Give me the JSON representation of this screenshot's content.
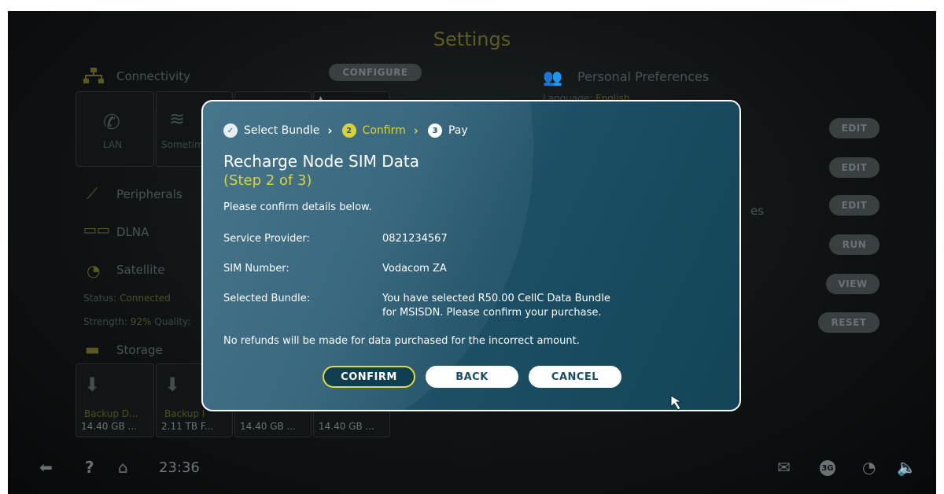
{
  "background": {
    "title": "Settings",
    "configure_label": "CONFIGURE",
    "sections": {
      "connectivity": "Connectivity",
      "peripherals": "Peripherals",
      "dlna": "DLNA",
      "satellite": "Satellite",
      "storage": "Storage",
      "personal_preferences": "Personal Preferences"
    },
    "language_label": "Language:",
    "language_value": "English",
    "tiles": {
      "lan": "LAN",
      "sometimes": "Sometim"
    },
    "status_label": "Status:",
    "status_value": "Connected",
    "strength_label": "Strength:",
    "strength_value": "92%",
    "quality_label": "Quality:",
    "storage_items": [
      {
        "name": "Backup D...",
        "size": "14.40 GB ..."
      },
      {
        "name": "Backup I",
        "size": "2.11 TB F..."
      },
      {
        "name": "",
        "size": "14.40 GB ..."
      },
      {
        "name": "",
        "size": "14.40 GB ..."
      }
    ],
    "right_buttons": [
      "EDIT",
      "EDIT",
      "EDIT",
      "RUN",
      "VIEW",
      "RESET"
    ],
    "partial_text": "es",
    "footer": {
      "time": "23:36",
      "help": "?",
      "network_badge": "3G"
    }
  },
  "modal": {
    "steps": [
      {
        "label": "Select Bundle",
        "marker": "✓",
        "state": "done"
      },
      {
        "label": "Confirm",
        "marker": "2",
        "state": "active"
      },
      {
        "label": "Pay",
        "marker": "3",
        "state": "pending"
      }
    ],
    "title": "Recharge Node SIM Data",
    "subtitle": "(Step 2 of 3)",
    "intro": "Please confirm details below.",
    "fields": [
      {
        "label": "Service Provider:",
        "value": "0821234567"
      },
      {
        "label": "SIM Number:",
        "value": "Vodacom ZA"
      },
      {
        "label": "Selected Bundle:",
        "value_line1": "You have selected R50.00 CellC Data Bundle",
        "value_line2": "for MSISDN. Please confirm your purchase."
      }
    ],
    "disclaimer": "No refunds will be made for data purchased for the incorrect amount.",
    "buttons": {
      "confirm": "CONFIRM",
      "back": "BACK",
      "cancel": "CANCEL"
    }
  },
  "colors": {
    "accent_yellow": "#e2db3a",
    "modal_blue": "#1c4f65",
    "active_step": "#d9d23b"
  }
}
